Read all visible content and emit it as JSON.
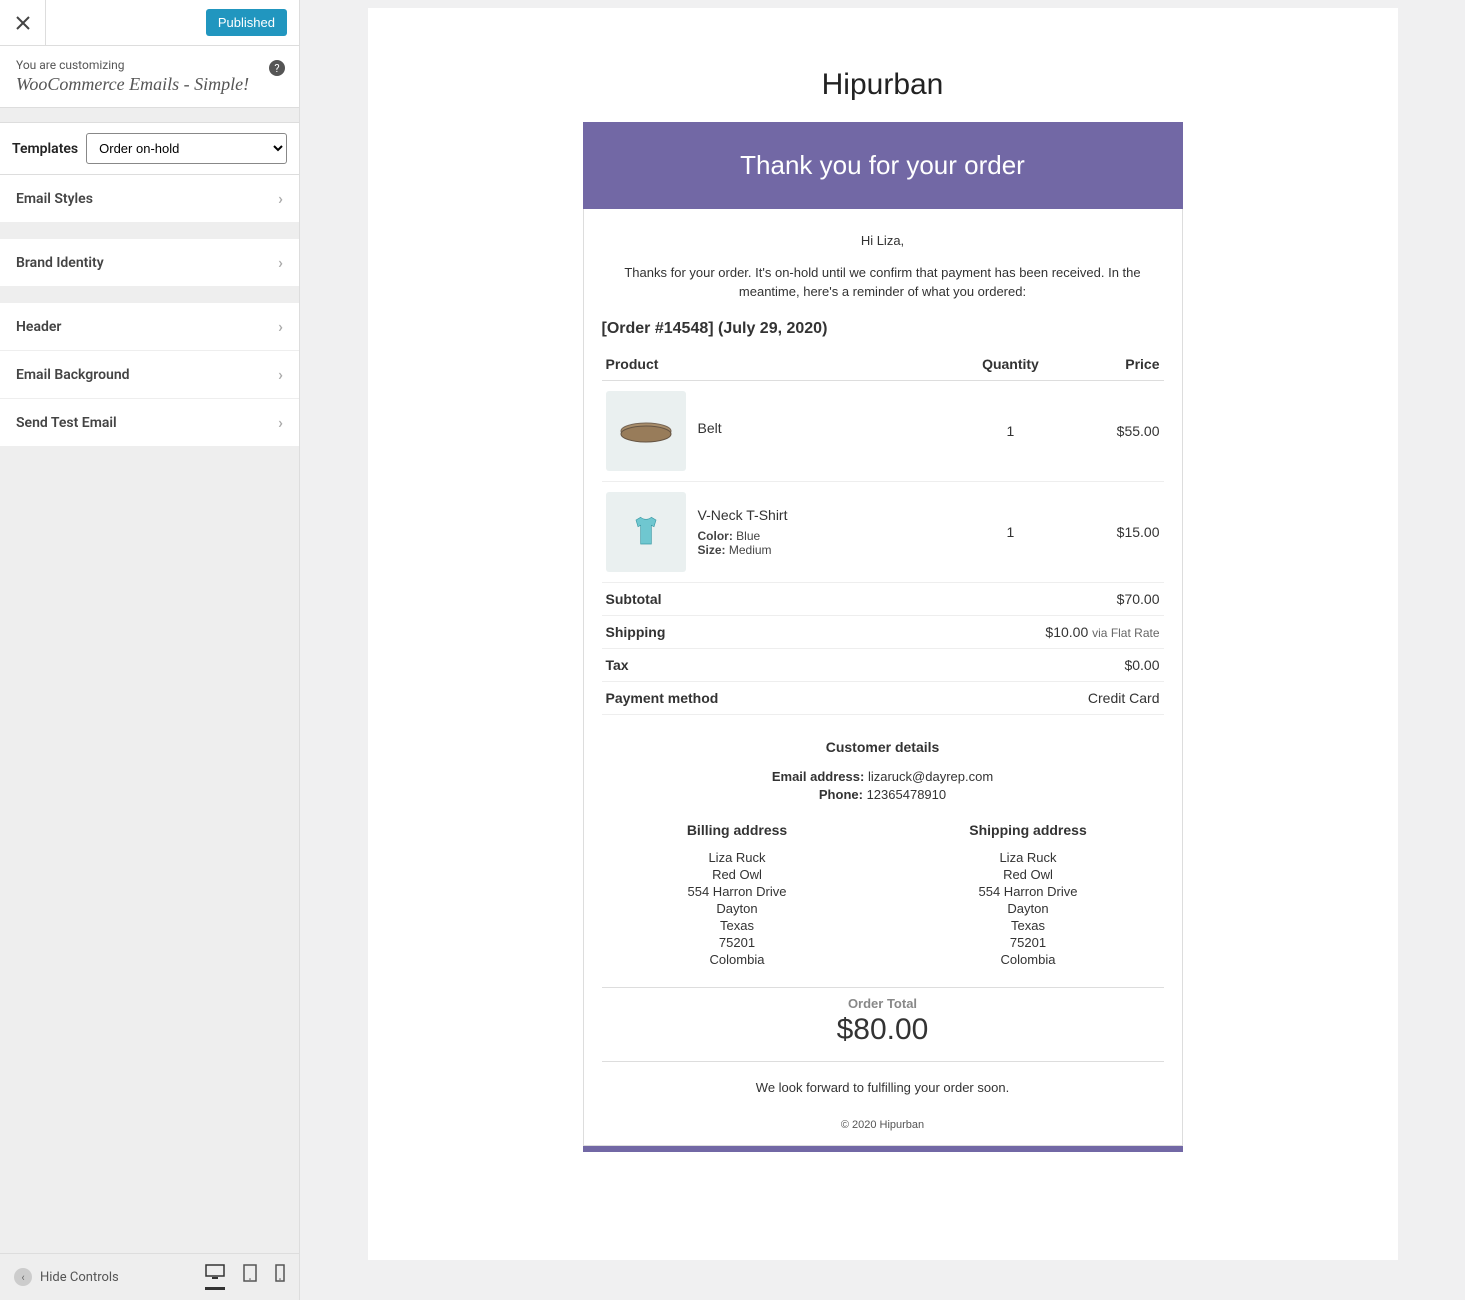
{
  "sidebar": {
    "published_label": "Published",
    "customizing_small": "You are customizing",
    "customizing_title": "WooCommerce Emails - Simple!",
    "templates_label": "Templates",
    "templates_selected": "Order on-hold",
    "items": [
      {
        "label": "Email Styles"
      },
      {
        "label": "Brand Identity"
      },
      {
        "label": "Header"
      },
      {
        "label": "Email Background"
      },
      {
        "label": "Send Test Email"
      }
    ],
    "hide_controls": "Hide Controls"
  },
  "email": {
    "brand": "Hipurban",
    "header": "Thank you for your order",
    "greeting": "Hi Liza,",
    "intro": "Thanks for your order. It's on-hold until we confirm that payment has been received. In the meantime, here's a reminder of what you ordered:",
    "order_line": "[Order #14548] (July 29, 2020)",
    "th_product": "Product",
    "th_qty": "Quantity",
    "th_price": "Price",
    "items": [
      {
        "name": "Belt",
        "qty": "1",
        "price": "$55.00"
      },
      {
        "name": "V-Neck T-Shirt",
        "color": "Blue",
        "size": "Medium",
        "qty": "1",
        "price": "$15.00"
      }
    ],
    "color_label": "Color:",
    "size_label": "Size:",
    "totals": {
      "subtotal_label": "Subtotal",
      "subtotal": "$70.00",
      "shipping_label": "Shipping",
      "shipping": "$10.00",
      "shipping_via": "via Flat Rate",
      "tax_label": "Tax",
      "tax": "$0.00",
      "payment_label": "Payment method",
      "payment": "Credit Card"
    },
    "customer": {
      "heading": "Customer details",
      "email_label": "Email address:",
      "email": "lizaruck@dayrep.com",
      "phone_label": "Phone:",
      "phone": "12365478910"
    },
    "billing": {
      "heading": "Billing address",
      "lines": [
        "Liza Ruck",
        "Red Owl",
        "554 Harron Drive",
        "Dayton",
        "Texas",
        "75201",
        "Colombia"
      ]
    },
    "shipping": {
      "heading": "Shipping address",
      "lines": [
        "Liza Ruck",
        "Red Owl",
        "554 Harron Drive",
        "Dayton",
        "Texas",
        "75201",
        "Colombia"
      ]
    },
    "order_total_label": "Order Total",
    "order_total": "$80.00",
    "closing": "We look forward to fulfilling your order soon.",
    "footer": "© 2020 Hipurban"
  }
}
